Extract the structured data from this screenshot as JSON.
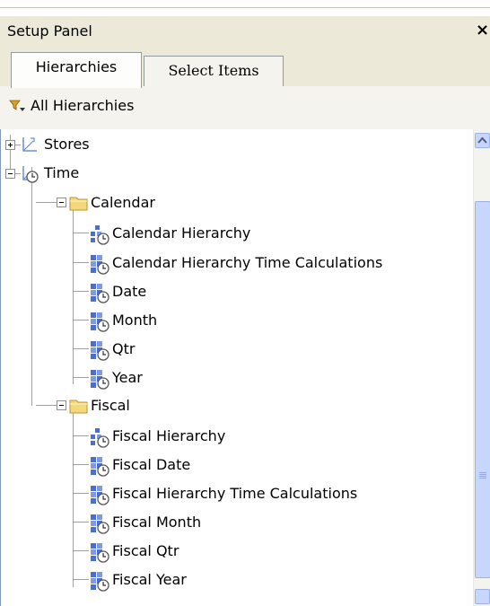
{
  "panel": {
    "title": "Setup Panel",
    "close_label": "×"
  },
  "tabs": [
    {
      "label": "Hierarchies"
    },
    {
      "label": "Select Items"
    }
  ],
  "filter": {
    "label": "All Hierarchies"
  },
  "tree": {
    "stores": "Stores",
    "time": "Time",
    "calendar": {
      "label": "Calendar",
      "items": [
        "Calendar Hierarchy",
        "Calendar Hierarchy Time Calculations",
        "Date",
        "Month",
        "Qtr",
        "Year"
      ]
    },
    "fiscal": {
      "label": "Fiscal",
      "items": [
        "Fiscal Hierarchy",
        "Fiscal Date",
        "Fiscal Hierarchy Time Calculations",
        "Fiscal Month",
        "Fiscal Qtr",
        "Fiscal Year"
      ]
    }
  },
  "icons": {
    "filter": "filter-icon",
    "dimension_stores": "dimension-icon",
    "dimension_time": "time-dimension-icon",
    "folder": "folder-icon",
    "hierarchy": "hierarchy-icon",
    "level": "time-level-icon"
  },
  "colors": {
    "panel_bg": "#ece9d8",
    "tab_border": "#919b9c",
    "folder": "#f5d77c",
    "level_blue": "#4a6fcf",
    "scroll_blue": "#c6d6fc"
  }
}
